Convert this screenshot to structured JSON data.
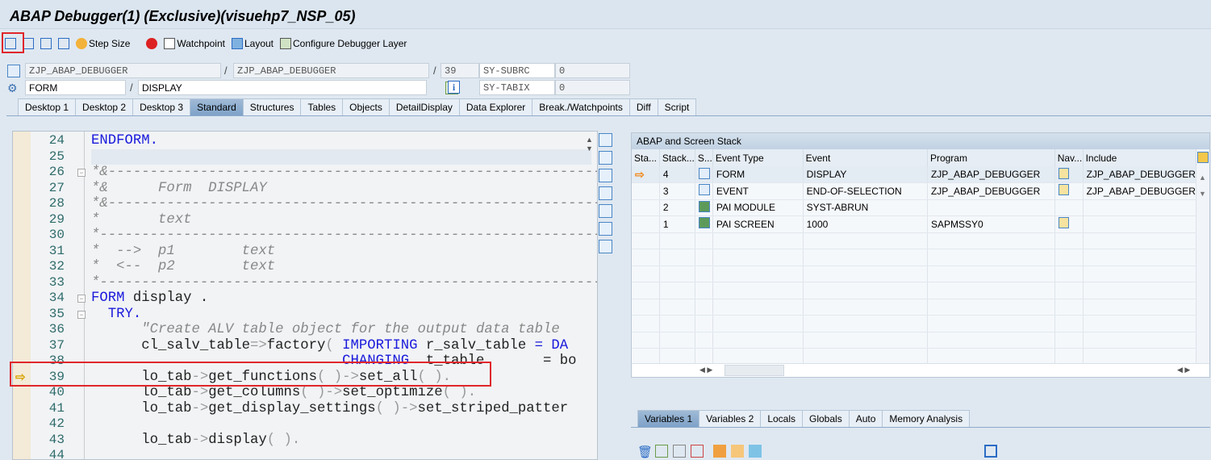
{
  "window": {
    "title": "ABAP Debugger(1)  (Exclusive)(visuehp7_NSP_05)"
  },
  "toolbar": {
    "items": [
      {
        "icon": "single-step-icon",
        "label": ""
      },
      {
        "icon": "execute-icon",
        "label": ""
      },
      {
        "icon": "return-icon",
        "label": ""
      },
      {
        "icon": "continue-icon",
        "label": ""
      },
      {
        "icon": "step-size-icon",
        "label": "Step Size"
      },
      {
        "icon": "stop-icon",
        "label": ""
      },
      {
        "icon": "document-icon",
        "label": "Watchpoint"
      },
      {
        "icon": "layout-icon",
        "label": "Layout"
      },
      {
        "icon": "configure-icon",
        "label": "Configure Debugger Layer"
      }
    ]
  },
  "fields": {
    "program": "ZJP_ABAP_DEBUGGER",
    "include": "ZJP_ABAP_DEBUGGER",
    "line": "39",
    "sy_subrc_label": "SY-SUBRC",
    "sy_subrc": "0",
    "event_type": "FORM",
    "event": "DISPLAY",
    "sy_tabix_label": "SY-TABIX",
    "sy_tabix": "0",
    "sep": "/"
  },
  "tabs": [
    "Desktop 1",
    "Desktop 2",
    "Desktop 3",
    "Standard",
    "Structures",
    "Tables",
    "Objects",
    "DetailDisplay",
    "Data Explorer",
    "Break./Watchpoints",
    "Diff",
    "Script"
  ],
  "active_tab": "Standard",
  "code": {
    "current_line": "39",
    "lines": [
      {
        "n": "24",
        "s": [
          [
            "ENDFORM.",
            "k"
          ]
        ]
      },
      {
        "n": "25",
        "s": []
      },
      {
        "n": "26",
        "s": [
          [
            "*&----------------------------------------------------------------------",
            "c"
          ]
        ]
      },
      {
        "n": "27",
        "s": [
          [
            "*&      Form  DISPLAY",
            "c"
          ]
        ]
      },
      {
        "n": "28",
        "s": [
          [
            "*&----------------------------------------------------------------------",
            "c"
          ]
        ]
      },
      {
        "n": "29",
        "s": [
          [
            "*       text",
            "c"
          ]
        ]
      },
      {
        "n": "30",
        "s": [
          [
            "*----------------------------------------------------------------------",
            "c"
          ]
        ]
      },
      {
        "n": "31",
        "s": [
          [
            "*  -->  p1        text",
            "c"
          ]
        ]
      },
      {
        "n": "32",
        "s": [
          [
            "*  <--  p2        text",
            "c"
          ]
        ]
      },
      {
        "n": "33",
        "s": [
          [
            "*----------------------------------------------------------------------",
            "c"
          ]
        ]
      },
      {
        "n": "34",
        "s": [
          [
            "FORM",
            "k"
          ],
          [
            " display .",
            ""
          ]
        ]
      },
      {
        "n": "35",
        "s": [
          [
            "  TRY.",
            "k"
          ]
        ]
      },
      {
        "n": "36",
        "s": [
          [
            "      \"Create ALV table object for the output data table",
            "c"
          ]
        ]
      },
      {
        "n": "37",
        "s": [
          [
            "      cl_salv_table",
            ""
          ],
          [
            "=>",
            "o"
          ],
          [
            "factory",
            ""
          ],
          [
            "( ",
            "o"
          ],
          [
            "IMPORTING",
            "k"
          ],
          [
            " r_salv_table ",
            ""
          ],
          [
            "= DA",
            "k"
          ]
        ]
      },
      {
        "n": "38",
        "s": [
          [
            "                              ",
            ""
          ],
          [
            "CHANGING",
            "k"
          ],
          [
            "  t_table       = bo",
            ""
          ]
        ]
      },
      {
        "n": "39",
        "s": [
          [
            "      lo_tab",
            ""
          ],
          [
            "->",
            "o"
          ],
          [
            "get_functions",
            ""
          ],
          [
            "( )->",
            "o"
          ],
          [
            "set_all",
            ""
          ],
          [
            "( ).",
            "o"
          ]
        ]
      },
      {
        "n": "40",
        "s": [
          [
            "      lo_tab",
            ""
          ],
          [
            "->",
            "o"
          ],
          [
            "get_columns",
            ""
          ],
          [
            "( )->",
            "o"
          ],
          [
            "set_optimize",
            ""
          ],
          [
            "( ).",
            "o"
          ]
        ]
      },
      {
        "n": "41",
        "s": [
          [
            "      lo_tab",
            ""
          ],
          [
            "->",
            "o"
          ],
          [
            "get_display_settings",
            ""
          ],
          [
            "( )->",
            "o"
          ],
          [
            "set_striped_patter",
            ""
          ]
        ]
      },
      {
        "n": "42",
        "s": []
      },
      {
        "n": "43",
        "s": [
          [
            "      lo_tab",
            ""
          ],
          [
            "->",
            "o"
          ],
          [
            "display",
            ""
          ],
          [
            "( ).",
            "o"
          ]
        ]
      },
      {
        "n": "44",
        "s": []
      }
    ]
  },
  "stack": {
    "title": "ABAP and Screen Stack",
    "columns": [
      "Sta...",
      "Stack...",
      "S...",
      "Event Type",
      "Event",
      "Program",
      "Nav...",
      "Include"
    ],
    "rows": [
      {
        "current": true,
        "level": "4",
        "type_icon": "form-icon",
        "event_type": "FORM",
        "event": "DISPLAY",
        "program": "ZJP_ABAP_DEBUGGER",
        "nav": true,
        "include": "ZJP_ABAP_DEBUGGER"
      },
      {
        "current": false,
        "level": "3",
        "type_icon": "form-icon",
        "event_type": "EVENT",
        "event": "END-OF-SELECTION",
        "program": "ZJP_ABAP_DEBUGGER",
        "nav": true,
        "include": "ZJP_ABAP_DEBUGGER"
      },
      {
        "current": false,
        "level": "2",
        "type_icon": "screen-icon",
        "event_type": "PAI MODULE",
        "event": "SYST-ABRUN",
        "program": "",
        "nav": false,
        "include": ""
      },
      {
        "current": false,
        "level": "1",
        "type_icon": "screen-icon",
        "event_type": "PAI SCREEN",
        "event": "1000",
        "program": "SAPMSSY0",
        "nav": true,
        "include": ""
      }
    ]
  },
  "var_tabs": [
    "Variables 1",
    "Variables 2",
    "Locals",
    "Globals",
    "Auto",
    "Memory Analysis"
  ],
  "active_var_tab": "Variables 1",
  "colors": {
    "accent": "#e0262b",
    "keyword": "#1a1adc",
    "comment": "#888888"
  }
}
